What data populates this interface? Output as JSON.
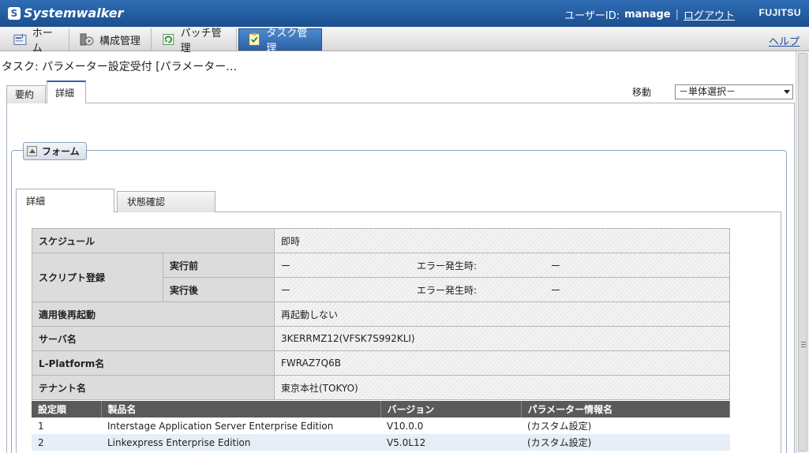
{
  "header": {
    "app_name": "Systemwalker",
    "user_label": "ユーザーID:",
    "user_id": "manage",
    "separator": "|",
    "logout": "ログアウト",
    "brand": "FUJITSU"
  },
  "nav": {
    "tabs": [
      {
        "label": "ホーム",
        "icon": "home-icon"
      },
      {
        "label": "構成管理",
        "icon": "configuration-icon"
      },
      {
        "label": "パッチ管理",
        "icon": "patch-icon"
      },
      {
        "label": "タスク管理",
        "icon": "task-icon",
        "active": true
      }
    ],
    "help": "ヘルプ"
  },
  "page": {
    "title": "タスク: パラメーター設定受付 [パラメーター…",
    "tabs": [
      "要約",
      "詳細"
    ],
    "active_tab": "詳細",
    "move_label": "移動",
    "move_select_value": "－単体選択－"
  },
  "form": {
    "legend": "フォーム",
    "tabs": [
      "詳細",
      "状態確認"
    ],
    "active_tab": "詳細"
  },
  "details": {
    "schedule": {
      "label": "スケジュール",
      "value": "即時"
    },
    "script": {
      "label": "スクリプト登録",
      "before": {
        "label": "実行前",
        "value": "ー",
        "error_label": "エラー発生時:",
        "error_value": "ー"
      },
      "after": {
        "label": "実行後",
        "value": "ー",
        "error_label": "エラー発生時:",
        "error_value": "ー"
      }
    },
    "restart": {
      "label": "適用後再起動",
      "value": "再起動しない"
    },
    "server": {
      "label": "サーバ名",
      "value": "3KERRMZ12(VFSK7S992KLI)"
    },
    "lplatform": {
      "label": "L-Platform名",
      "value": "FWRAZ7Q6B"
    },
    "tenant": {
      "label": "テナント名",
      "value": "東京本社(TOKYO)"
    }
  },
  "products": {
    "headers": [
      "設定順",
      "製品名",
      "バージョン",
      "パラメーター情報名"
    ],
    "rows": [
      [
        "1",
        "Interstage Application Server Enterprise Edition",
        "V10.0.0",
        "(カスタム設定)"
      ],
      [
        "2",
        "Linkexpress Enterprise Edition",
        "V5.0L12",
        "(カスタム設定)"
      ]
    ]
  },
  "colors": {
    "header_blue": "#2f6db5",
    "active_tab_blue": "#2d63a6",
    "label_gray": "#dcdcdc",
    "table_header": "#5a5a5a",
    "row_alt": "#e6eef7"
  }
}
